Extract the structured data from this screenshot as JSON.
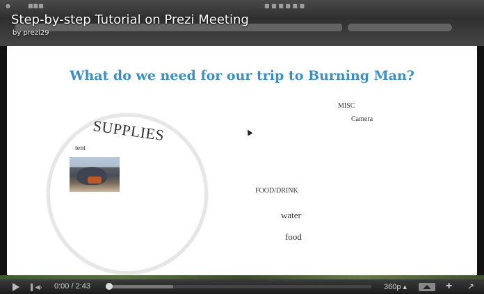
{
  "video": {
    "title": "Step-by-step Tutorial on Prezi Meeting",
    "byline": "by prezi29"
  },
  "slide": {
    "heading": "What do we need for our trip to Burning Man?",
    "supplies": "SUPPLIES",
    "tent": "tent",
    "misc": "MISC",
    "camera": "Camera",
    "food_drink": "FOOD/DRINK",
    "water": "water",
    "food": "food"
  },
  "controls": {
    "time": "0:00 / 2:43",
    "quality": "360p ▴",
    "progress_fraction": 0,
    "buffered_fraction": 0.25,
    "expand_icon": "+",
    "fullscreen_icon": "↗"
  },
  "colors": {
    "heading": "#3a8fc8"
  }
}
